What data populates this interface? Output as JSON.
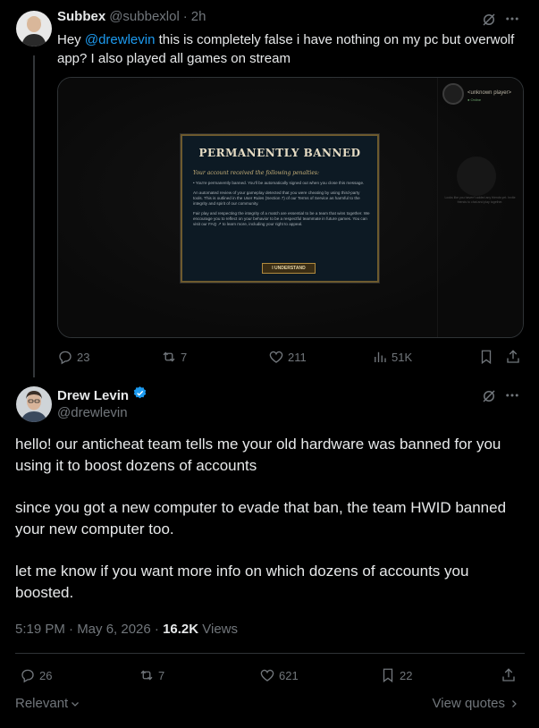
{
  "tweet1": {
    "author_name": "Subbex",
    "author_handle": "@subbexlol",
    "separator": "·",
    "time": "2h",
    "text_prefix": "Hey ",
    "mention": "@drewlevin",
    "text_suffix": " this is completely false i have nothing on my pc but overwolf app? I also played all games on stream",
    "media": {
      "dialog_title": "PERMANENTLY BANNED",
      "dialog_subtitle": "Your account received the following penalties:",
      "dialog_lines": [
        "• You're permanently banned. You'll be automatically signed out when you close this message.",
        "An automated review of your gameplay detected that you were cheating by using third-party tools. This is outlined in the User Rules (Section 7) of our Terms of Service as harmful to the integrity and spirit of our community.",
        "Fair play and respecting the integrity of a match are essential to be a team that wins together. We encourage you to reflect on your behavior to be a respectful teammate in future games. You can visit our FAQ ↗ to learn more, including your right to appeal."
      ],
      "dialog_button": "I UNDERSTAND",
      "side_name": "<unknown player>",
      "side_status": "● Online",
      "side_hint": "Looks like you haven't added any friends yet. Invite friends to chat and play together."
    },
    "actions": {
      "replies": "23",
      "reposts": "7",
      "likes": "211",
      "views": "51K"
    }
  },
  "tweet2": {
    "author_name": "Drew Levin",
    "author_handle": "@drewlevin",
    "paragraphs": [
      "hello! our anticheat team tells me your old hardware was banned for you using it to boost dozens of accounts",
      "since you got a new computer to evade that ban, the team HWID banned your new computer too.",
      "let me know if you want more info on which dozens of accounts you boosted."
    ],
    "timestamp": "5:19 PM · May 6, 2026 · ",
    "views_count": "16.2K",
    "views_label": " Views",
    "actions": {
      "replies": "26",
      "reposts": "7",
      "likes": "621",
      "bookmarks": "22"
    }
  },
  "footer": {
    "sort_label": "Relevant",
    "view_quotes": "View quotes"
  },
  "colors": {
    "background": "#000000",
    "text": "#e7e9ea",
    "muted": "#71767b",
    "link": "#1d9bf0",
    "verified": "#1d9bf0",
    "border": "#2f3336"
  },
  "icons": [
    "grok-icon",
    "more-icon",
    "reply-icon",
    "repost-icon",
    "like-icon",
    "views-icon",
    "bookmark-icon",
    "share-icon",
    "verified-badge-icon",
    "chevron-down-icon",
    "chevron-right-icon"
  ]
}
